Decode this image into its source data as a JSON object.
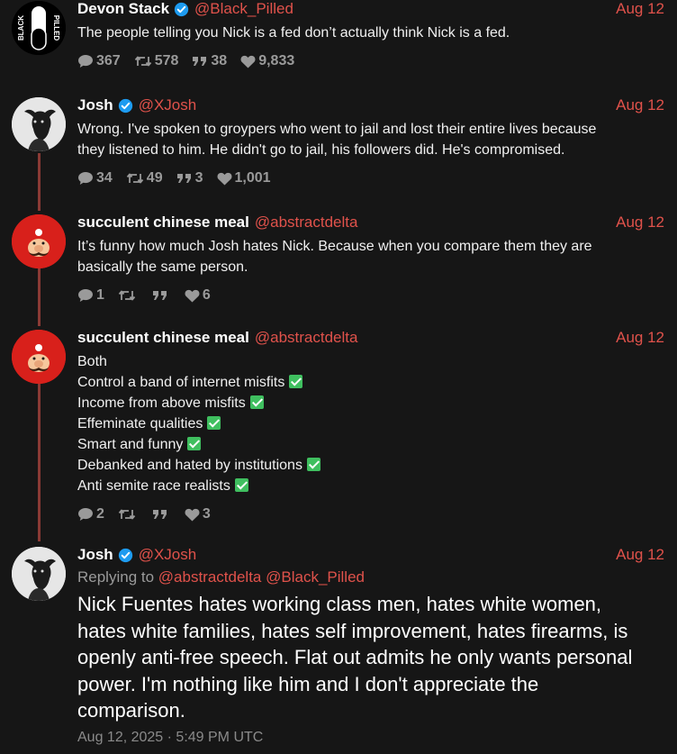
{
  "tweets": [
    {
      "name": "Devon Stack",
      "handle": "@Black_Pilled",
      "date": "Aug 12",
      "verified": true,
      "avatar": "black-pill-logo",
      "avatar_text": "BLACK PILLED",
      "text": "The people telling you Nick is a fed don’t actually think Nick is a fed.",
      "stats": {
        "replies": "367",
        "retweets": "578",
        "quotes": "38",
        "likes": "9,833"
      }
    },
    {
      "name": "Josh",
      "handle": "@XJosh",
      "date": "Aug 12",
      "verified": true,
      "avatar": "bull-mask-photo",
      "text_lines": [
        "Wrong. I've spoken to groypers who went to jail and lost their entire lives because",
        "they listened to him. He didn't go to jail, his followers did. He's compromised."
      ],
      "stats": {
        "replies": "34",
        "retweets": "49",
        "quotes": "3",
        "likes": "1,001"
      }
    },
    {
      "name": "succulent chinese meal",
      "handle": "@abstractdelta",
      "date": "Aug 12",
      "verified": false,
      "avatar": "mario-face",
      "text_lines": [
        "It’s funny how much Josh hates Nick. Because when you compare them they are",
        "basically the same person."
      ],
      "stats": {
        "replies": "1",
        "retweets": "",
        "quotes": "",
        "likes": "6"
      }
    },
    {
      "name": "succulent chinese meal",
      "handle": "@abstractdelta",
      "date": "Aug 12",
      "verified": false,
      "avatar": "mario-face",
      "text_lines": [
        "Both",
        "Control a band of internet misfits",
        "Income from above misfits",
        "Effeminate qualities",
        "Smart and funny",
        "Debanked and hated by institutions",
        "Anti semite race realists"
      ],
      "stats": {
        "replies": "2",
        "retweets": "",
        "quotes": "",
        "likes": "3"
      }
    },
    {
      "name": "Josh",
      "handle": "@XJosh",
      "date": "Aug 12",
      "verified": true,
      "avatar": "bull-mask-photo",
      "reply_prefix": "Replying to",
      "reply_mentions": [
        "@abstractdelta",
        "@Black_Pilled"
      ],
      "text_lines": [
        "Nick Fuentes hates working class men, hates white women,",
        "hates white families, hates self improvement, hates firearms, is",
        "openly anti-free speech. Flat out admits he only wants personal",
        "power. I'm nothing like him and I don't appreciate the",
        "comparison."
      ],
      "timestamp": "Aug 12, 2025 · 5:49 PM UTC"
    }
  ],
  "colors": {
    "accent": "#e0524b",
    "thread_line": "#8a3a35",
    "background": "#161616",
    "check": "#3fbf5f",
    "verified": "#1d9bf0"
  },
  "icons": [
    "verified-badge-icon",
    "reply-icon",
    "retweet-icon",
    "quote-icon",
    "heart-icon",
    "checkmark-icon"
  ]
}
